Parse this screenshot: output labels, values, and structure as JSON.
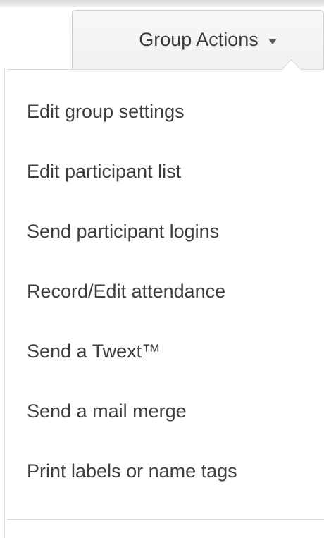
{
  "group_actions": {
    "label": "Group Actions",
    "caret_icon": "caret-down-icon",
    "items": [
      {
        "label": "Edit group settings"
      },
      {
        "label": "Edit participant list"
      },
      {
        "label": "Send participant logins"
      },
      {
        "label": "Record/Edit attendance"
      },
      {
        "label": "Send a Twext™"
      },
      {
        "label": "Send a mail merge"
      },
      {
        "label": "Print labels or name tags"
      }
    ]
  },
  "colors": {
    "text": "#3e3e3e",
    "border": "#d8d8d8",
    "tab_background": "#f4f4f4"
  }
}
